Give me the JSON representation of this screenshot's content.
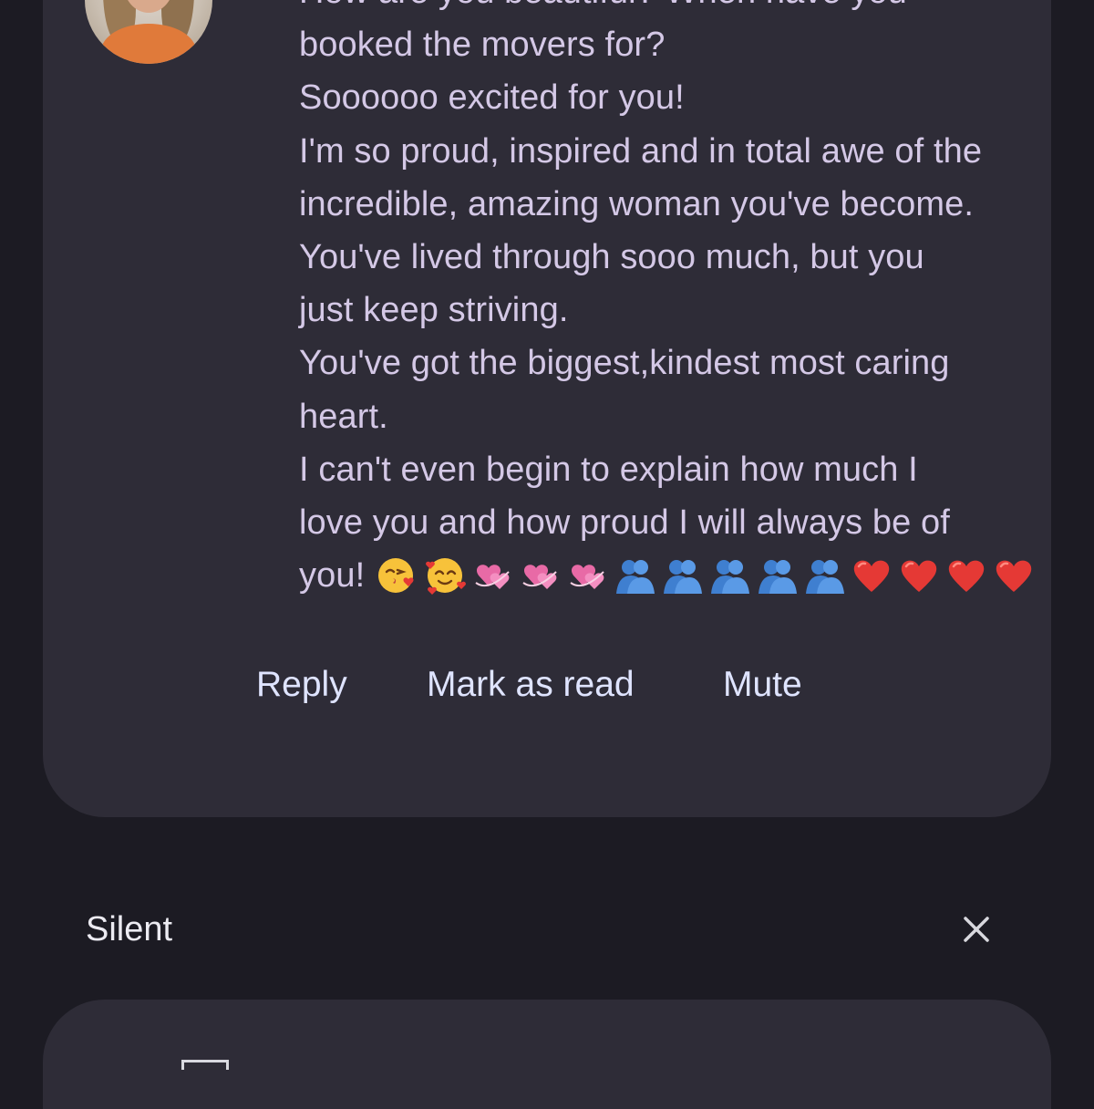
{
  "notification": {
    "message_lines": [
      "How are you beautiful? When have you",
      "booked the movers for?",
      "Soooooo excited for you!",
      "I'm so proud, inspired and in total awe of the",
      "incredible, amazing woman you've become.",
      "You've lived through sooo much, but you",
      "just keep striving.",
      "You've got the biggest,kindest most caring",
      "heart.",
      "I can't even begin to explain how much I",
      "love you and how proud I will always be of"
    ],
    "last_line_text": "you!",
    "emojis": [
      "kissing-heart-emoji",
      "smiling-hearts-emoji",
      "revolving-hearts-emoji",
      "revolving-hearts-emoji",
      "revolving-hearts-emoji",
      "hugging-people-emoji",
      "hugging-people-emoji",
      "hugging-people-emoji",
      "hugging-people-emoji",
      "hugging-people-emoji",
      "red-heart-emoji",
      "red-heart-emoji",
      "red-heart-emoji",
      "red-heart-emoji"
    ],
    "actions": {
      "reply": "Reply",
      "mark_as_read": "Mark as read",
      "mute": "Mute"
    }
  },
  "silent_section": {
    "title": "Silent",
    "close_icon": "close-icon"
  },
  "colors": {
    "background": "#1c1b23",
    "card": "#2e2c37",
    "message_text": "#d4c8e6",
    "action_text": "#dfe4ff",
    "section_title": "#ecebf2"
  }
}
